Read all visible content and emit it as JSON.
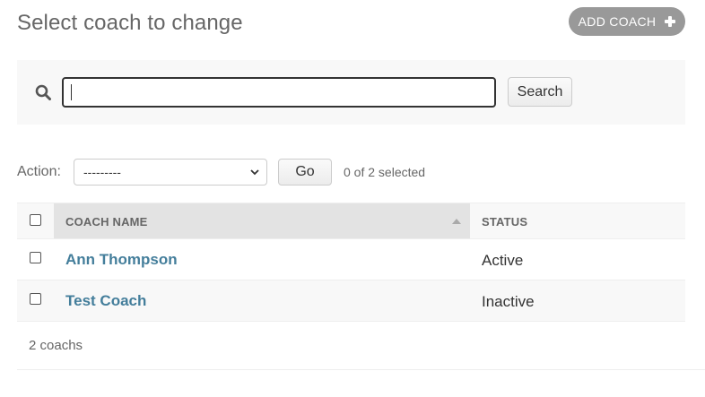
{
  "header": {
    "title": "Select coach to change",
    "add_button_label": "ADD COACH"
  },
  "search": {
    "value": "",
    "button_label": "Search"
  },
  "actions": {
    "label": "Action:",
    "selected_option": "---------",
    "go_label": "Go",
    "selected_count": "0 of 2 selected"
  },
  "table": {
    "columns": [
      "COACH NAME",
      "STATUS"
    ],
    "rows": [
      {
        "name": "Ann Thompson",
        "status": "Active"
      },
      {
        "name": "Test Coach",
        "status": "Inactive"
      }
    ]
  },
  "paginator": {
    "text": "2 coachs"
  },
  "colors": {
    "link": "#447e9b",
    "add_button": "#999999",
    "header_sorted": "#e3e3e3"
  },
  "icons": [
    "search-icon",
    "plus-icon",
    "chevron-down-icon",
    "sort-ascending-icon"
  ]
}
